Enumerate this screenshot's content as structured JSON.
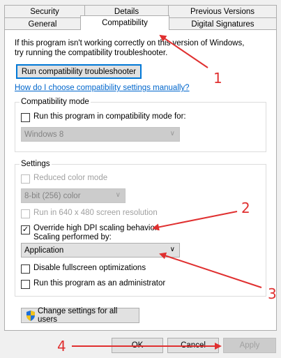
{
  "tabs": {
    "row1": [
      "Security",
      "Details",
      "Previous Versions"
    ],
    "row2": [
      "General",
      "Compatibility",
      "Digital Signatures"
    ],
    "active": "Compatibility"
  },
  "intro": {
    "line1": "If this program isn't working correctly on this version of Windows,",
    "line2": "try running the compatibility troubleshooter."
  },
  "troubleshooter_button": "Run compatibility troubleshooter",
  "manual_link": "How do I choose compatibility settings manually?",
  "compat_mode": {
    "legend": "Compatibility mode",
    "checkbox_label": "Run this program in compatibility mode for:",
    "checked": false,
    "os_select": "Windows 8"
  },
  "settings": {
    "legend": "Settings",
    "reduced_color": "Reduced color mode",
    "color_select": "8-bit (256) color",
    "res_640": "Run in 640 x 480 screen resolution",
    "override_dpi_line1": "Override high DPI scaling behavior.",
    "override_dpi_line2": "Scaling performed by:",
    "override_dpi_checked": true,
    "scaling_select": "Application",
    "disable_fullscreen": "Disable fullscreen optimizations",
    "run_as_admin": "Run this program as an administrator"
  },
  "change_all_users_button": "Change settings for all users",
  "footer": {
    "ok": "OK",
    "cancel": "Cancel",
    "apply": "Apply"
  },
  "annotations": [
    "1",
    "2",
    "3",
    "4"
  ],
  "colors": {
    "annotation_red": "#e03030",
    "link_blue": "#0066cc",
    "focus_blue": "#0078d7"
  }
}
